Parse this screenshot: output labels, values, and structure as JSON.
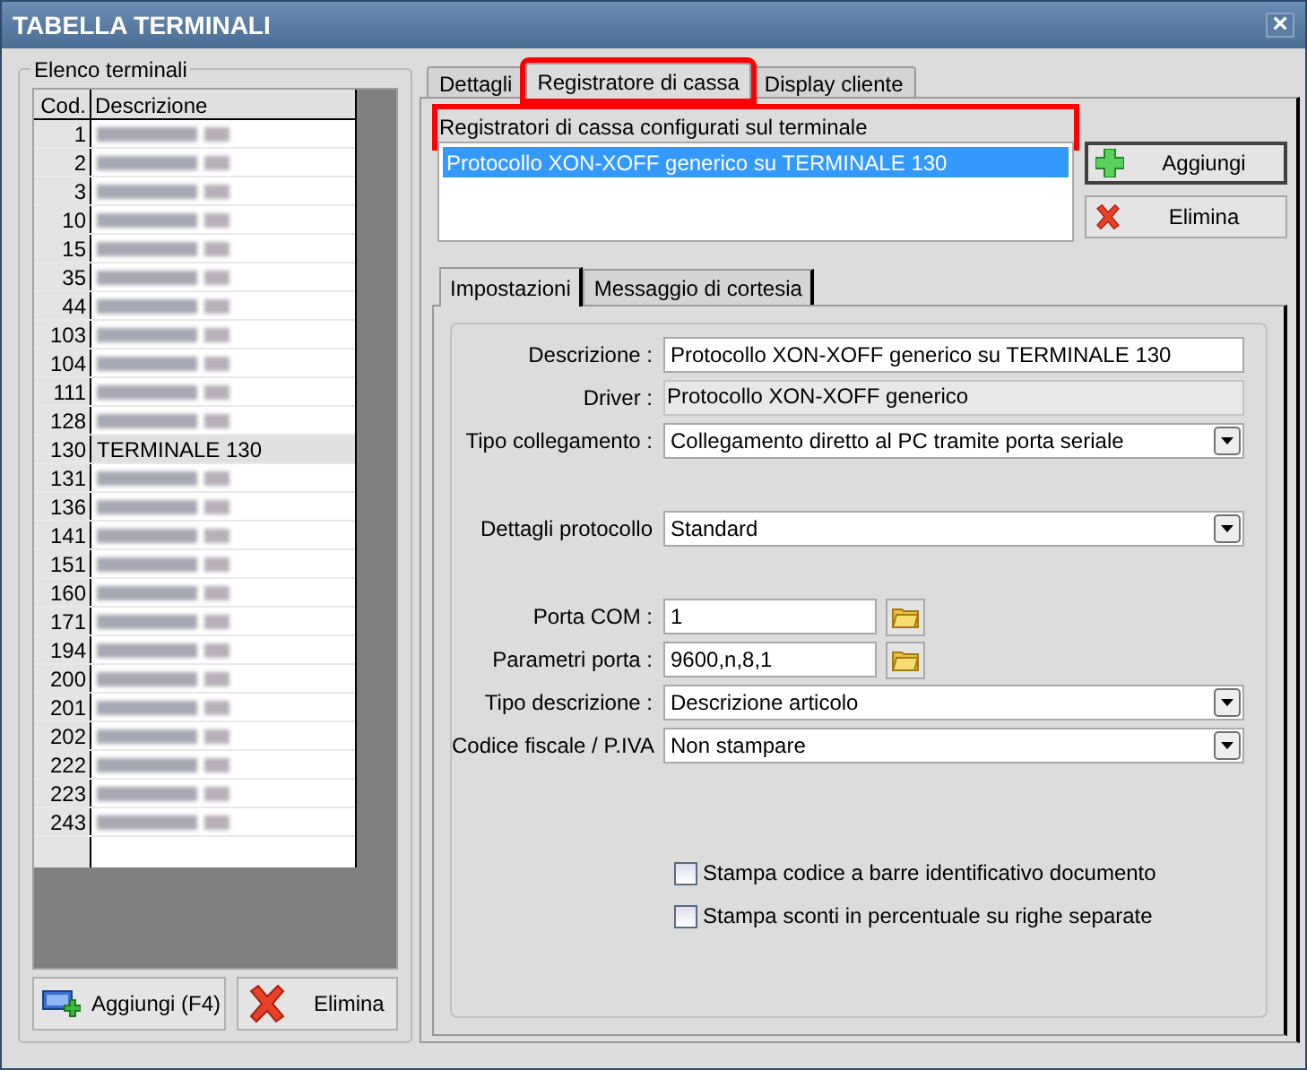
{
  "window": {
    "title": "TABELLA TERMINALI",
    "close": "×"
  },
  "terminals": {
    "group_title": "Elenco terminali",
    "columns": [
      "Cod.",
      "Descrizione"
    ],
    "rows": [
      {
        "code": "1",
        "kind": "blurred",
        "selected": false
      },
      {
        "code": "2",
        "kind": "blurred",
        "selected": false
      },
      {
        "code": "3",
        "kind": "blurred",
        "selected": false
      },
      {
        "code": "10",
        "kind": "blurred",
        "selected": false
      },
      {
        "code": "15",
        "kind": "blurred",
        "selected": false
      },
      {
        "code": "35",
        "kind": "blurred",
        "selected": false
      },
      {
        "code": "44",
        "kind": "blurred",
        "selected": false
      },
      {
        "code": "103",
        "kind": "blurred",
        "selected": false
      },
      {
        "code": "104",
        "kind": "blurred",
        "selected": false
      },
      {
        "code": "111",
        "kind": "blurred",
        "selected": false
      },
      {
        "code": "128",
        "kind": "blurred",
        "selected": false
      },
      {
        "code": "130",
        "kind": "text",
        "description": "TERMINALE 130",
        "selected": true
      },
      {
        "code": "131",
        "kind": "blurred",
        "selected": false
      },
      {
        "code": "136",
        "kind": "blurred",
        "selected": false
      },
      {
        "code": "141",
        "kind": "blurred",
        "selected": false
      },
      {
        "code": "151",
        "kind": "blurred",
        "selected": false
      },
      {
        "code": "160",
        "kind": "blurred",
        "selected": false
      },
      {
        "code": "171",
        "kind": "blurred",
        "selected": false
      },
      {
        "code": "194",
        "kind": "blurred",
        "selected": false
      },
      {
        "code": "200",
        "kind": "blurred",
        "selected": false
      },
      {
        "code": "201",
        "kind": "blurred",
        "selected": false
      },
      {
        "code": "202",
        "kind": "blurred",
        "selected": false
      },
      {
        "code": "222",
        "kind": "blurred",
        "selected": false
      },
      {
        "code": "223",
        "kind": "blurred",
        "selected": false
      },
      {
        "code": "243",
        "kind": "blurred",
        "selected": false
      }
    ],
    "buttons": [
      "Aggiungi (F4)",
      "Elimina"
    ]
  },
  "tabs": [
    {
      "label": "Dettagli",
      "selected": false,
      "highlighted": false
    },
    {
      "label": "Registratore di cassa",
      "selected": true,
      "highlighted": true
    },
    {
      "label": "Display cliente",
      "selected": false,
      "highlighted": false
    }
  ],
  "registers": {
    "title": "Registratori di cassa configurati sul terminale",
    "highlighted": true,
    "items": [
      {
        "label": "Protocollo XON-XOFF generico su TERMINALE 130",
        "selected": true
      }
    ],
    "buttons": [
      "Aggiungi",
      "Elimina"
    ]
  },
  "subtabs": [
    {
      "label": "Impostazioni",
      "selected": true
    },
    {
      "label": "Messaggio di cortesia",
      "selected": false
    }
  ],
  "fields": [
    {
      "label": "Descrizione :",
      "kind": "text",
      "value": "Protocollo XON-XOFF generico su TERMINALE 130"
    },
    {
      "label": "Driver :",
      "kind": "readonly",
      "value": "Protocollo XON-XOFF generico"
    },
    {
      "label": "Tipo collegamento :",
      "kind": "dropdown",
      "value": "Collegamento diretto al PC tramite porta seriale"
    },
    {
      "label": "Dettagli protocollo",
      "kind": "dropdown",
      "value": "Standard"
    },
    {
      "label": "Porta COM :",
      "kind": "browse",
      "value": "1"
    },
    {
      "label": "Parametri porta :",
      "kind": "browse",
      "value": "9600,n,8,1"
    },
    {
      "label": "Tipo descrizione :",
      "kind": "dropdown",
      "value": "Descrizione articolo"
    },
    {
      "label": "Codice fiscale / P.IVA",
      "kind": "dropdown",
      "value": "Non stampare"
    }
  ],
  "options": [
    {
      "label": "Stampa codice a barre identificativo documento",
      "checked": false
    },
    {
      "label": "Stampa sconti in percentuale su righe separate",
      "checked": false
    }
  ]
}
